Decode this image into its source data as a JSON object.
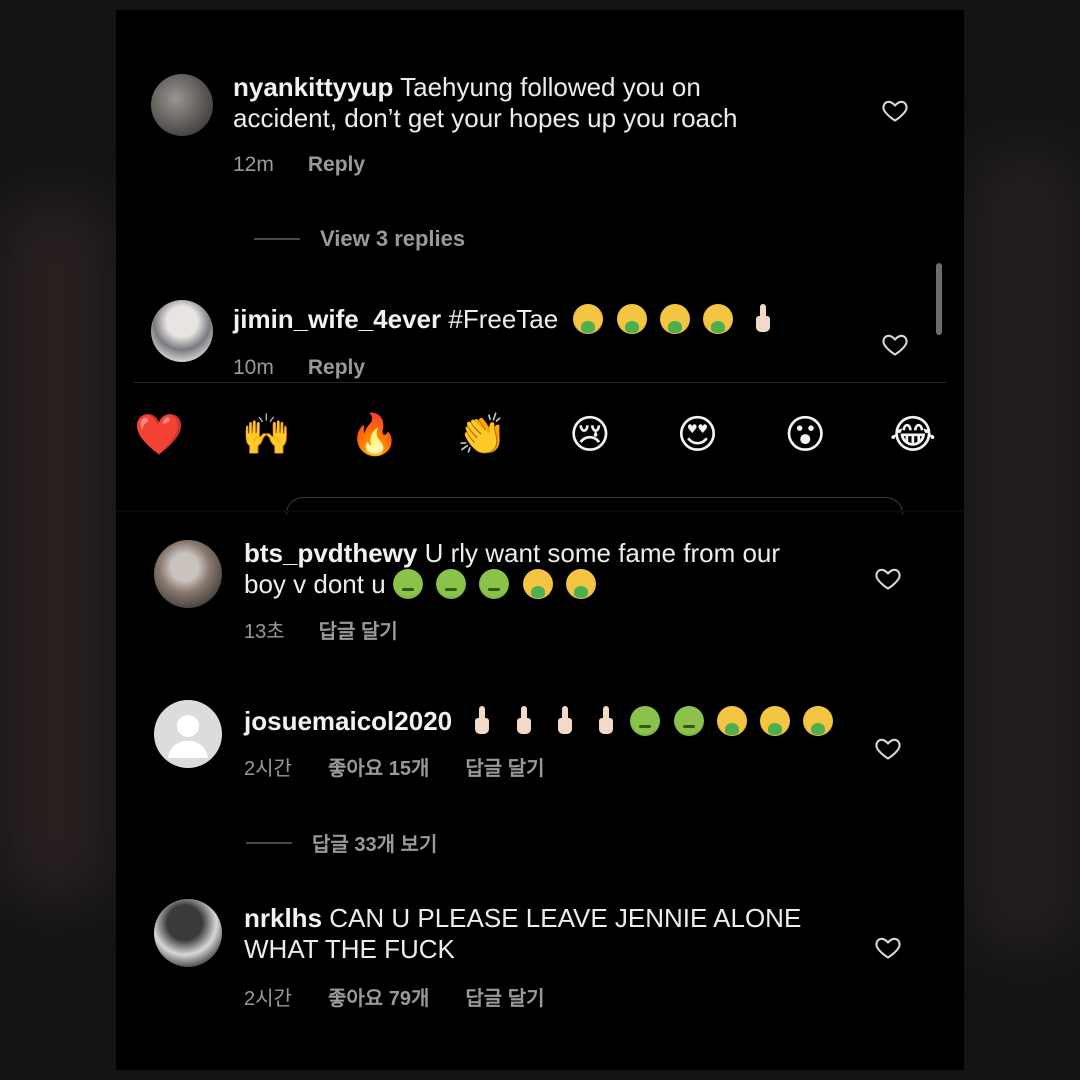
{
  "comments_top": [
    {
      "username": "nyankittyyup",
      "text_line1": "Taehyung followed you on",
      "text_line2": "accident, don’t get your hopes up you roach",
      "time": "12m",
      "reply": "Reply",
      "view_replies": "View 3 replies"
    },
    {
      "username": "jimin_wife_4ever",
      "text": "#FreeTae",
      "emojis": [
        "face-vomiting",
        "face-vomiting",
        "face-vomiting",
        "face-vomiting",
        "middle-finger"
      ],
      "time": "10m",
      "reply": "Reply"
    }
  ],
  "reaction_bar": {
    "emojis": [
      "❤️",
      "🙌",
      "🔥",
      "👏",
      "😢",
      "😍",
      "😮",
      "😂"
    ],
    "names": [
      "red-heart",
      "raising-hands",
      "fire",
      "clapping-hands",
      "crying-face",
      "heart-eyes",
      "open-mouth",
      "tears-of-joy"
    ]
  },
  "comments_bottom": [
    {
      "username": "bts_pvdthewy",
      "text_line1": "U rly want some fame from our",
      "text_line2": "boy v dont u",
      "emojis": [
        "nauseated",
        "nauseated",
        "nauseated",
        "face-vomiting",
        "face-vomiting"
      ],
      "time": "13초",
      "reply": "답글 달기"
    },
    {
      "username": "josuemaicol2020",
      "emojis": [
        "middle-finger",
        "middle-finger",
        "middle-finger",
        "middle-finger",
        "nauseated",
        "nauseated",
        "face-vomiting",
        "face-vomiting",
        "face-vomiting"
      ],
      "time": "2시간",
      "likes": "좋아요 15개",
      "reply": "답글 달기",
      "view_replies": "답글 33개 보기"
    },
    {
      "username": "nrklhs",
      "text_line1": "CAN U PLEASE LEAVE JENNIE ALONE",
      "text_line2": "WHAT THE FUCK",
      "time": "2시간",
      "likes": "좋아요 79개",
      "reply": "답글 달기"
    }
  ],
  "colors": {
    "background": "#000000",
    "text": "#ededed",
    "muted": "#9a9a9a"
  }
}
